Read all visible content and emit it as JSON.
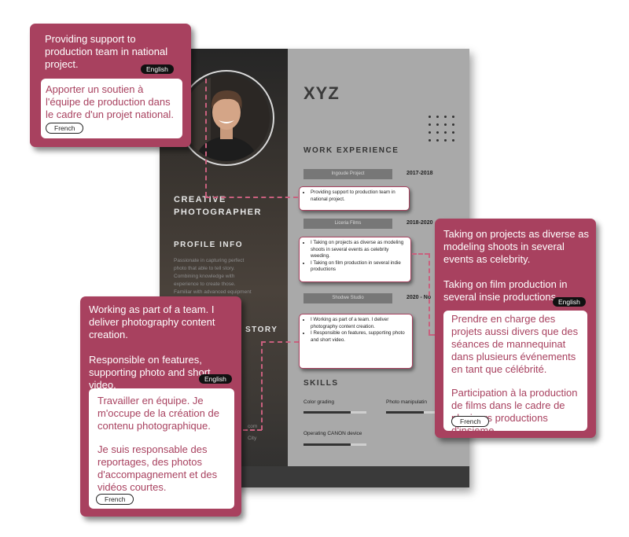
{
  "resume": {
    "name": "XYZ",
    "role_line1": "CREATIVE",
    "role_line2": "PHOTOGRAPHER",
    "profile_title": "PROFILE INFO",
    "profile_text": [
      "Passionate in capturing perfect",
      "photo that able to tell story.",
      "Combining knowledge with",
      "experience to create those.",
      "Familiar with advanced equipment"
    ],
    "history_title_fragment": "STORY",
    "contact_fragment_1": "com",
    "contact_fragment_2": "City",
    "work_title": "WORK EXPERIENCE",
    "jobs": [
      {
        "company": "Ingoude Project",
        "years": "2017-2018",
        "bullets": [
          "Providing support to production team in national project."
        ]
      },
      {
        "company": "Liceria Films",
        "years": "2018-2020",
        "bullets": [
          "I Taking on projects as diverse as modeling shoots in several events as celebrity weeding.",
          "I Taking on film production in several indie productions"
        ]
      },
      {
        "company": "Shodwe Studio",
        "years": "2020 - No",
        "bullets": [
          "I Working as part of a team. I deliver photography content creation.",
          "I Responsible on features, supporting photo and short video."
        ]
      }
    ],
    "skills_title": "SKILLS",
    "skills": [
      {
        "label": "Color grading",
        "level": 0.75
      },
      {
        "label": "Photo manipulatin",
        "level": 0.6
      },
      {
        "label": "Operating CANON device",
        "level": 0.75
      }
    ]
  },
  "callouts": [
    {
      "english": "Providing support to production team in national project.",
      "french": "Apporter un soutien à l'équipe de production dans le cadre d'un projet national.",
      "english_tag": "English",
      "french_tag": "French"
    },
    {
      "english_p1": "Taking on projects as diverse as modeling shoots in several events as celebrity.",
      "english_p2": "Taking on film production in several insie productions.",
      "french_p1": "Prendre en charge des projets aussi divers que des séances de mannequinat dans plusieurs événements en tant que célébrité.",
      "french_p2": "Participation à la production de films dans le cadre de plusieurs productions d'insieme.",
      "english_tag": "English",
      "french_tag": "French"
    },
    {
      "english_p1": "Working as part of a team. I deliver photography content creation.",
      "english_p2": "Responsible on features, supporting photo and short video.",
      "french_p1": "Travailler en équipe. Je m'occupe de la création de contenu photographique.",
      "french_p2": "Je suis responsable des reportages, des photos d'accompagnement et des vidéos courtes.",
      "english_tag": "English",
      "french_tag": "French"
    }
  ],
  "colors": {
    "accent": "#a8415f",
    "connector": "#c9607e"
  }
}
